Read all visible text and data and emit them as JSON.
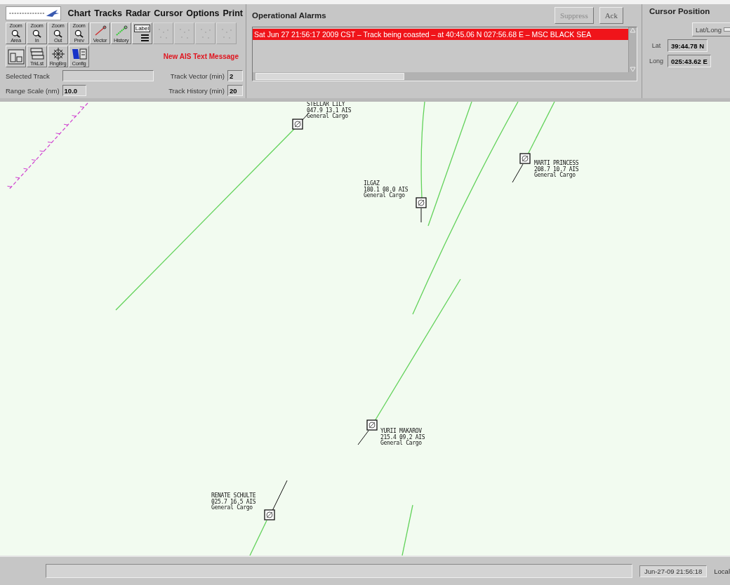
{
  "menu": [
    "Chart",
    "Tracks",
    "Radar",
    "Cursor",
    "Options",
    "Print"
  ],
  "toolbar": {
    "rows": [
      [
        {
          "kind": "zoom",
          "top": "Zoom",
          "caption": "Area",
          "disabled": false
        },
        {
          "kind": "zoom",
          "top": "Zoom",
          "caption": "In",
          "disabled": false
        },
        {
          "kind": "zoom",
          "top": "Zoom",
          "caption": "Out",
          "disabled": false
        },
        {
          "kind": "zoom",
          "top": "Zoom",
          "caption": "Prev",
          "disabled": false
        },
        {
          "kind": "vector",
          "caption": "Vector",
          "disabled": false
        },
        {
          "kind": "history",
          "caption": "History",
          "disabled": false
        },
        {
          "kind": "label",
          "caption": "Label",
          "disabled": false
        },
        {
          "kind": "faded",
          "disabled": true
        },
        {
          "kind": "faded",
          "disabled": true
        },
        {
          "kind": "faded",
          "disabled": true
        },
        {
          "kind": "faded",
          "disabled": true
        }
      ],
      [
        {
          "kind": "pip",
          "disabled": false
        },
        {
          "kind": "tracklist",
          "caption": "TrkLst",
          "disabled": false
        },
        {
          "kind": "rangebearing",
          "caption": "RngBrg",
          "disabled": false
        },
        {
          "kind": "config",
          "caption": "Config",
          "disabled": false
        }
      ]
    ],
    "notice": "New AIS Text Message",
    "fields": [
      {
        "label": "Selected Track"
      },
      {
        "label": "Track Vector (min)",
        "value": "2"
      },
      {
        "label": "Range Scale (nm)",
        "value": "10.0"
      },
      {
        "label": "Track History (min)",
        "value": "20"
      }
    ]
  },
  "alarms": {
    "title": "Operational Alarms",
    "buttons": [
      {
        "label": "Suppress",
        "disabled": true
      },
      {
        "label": "Ack",
        "disabled": false
      }
    ],
    "rows": [
      {
        "text": "Sat Jun 27 21:56:17 2009 CST – Track being coasted –  at  40:45.06 N 027:56.68 E – MSC BLACK SEA",
        "selected": true
      }
    ]
  },
  "cursor_position": {
    "title": "Cursor Position",
    "mode_button": "Lat/Long",
    "lat_label": "Lat",
    "lat": "39:44.78 N",
    "long_label": "Long",
    "long": "025:43.62 E"
  },
  "tracks": [
    {
      "name": "STELLAR LILY",
      "data": "047.9 13.1 AIS",
      "type": "General Cargo"
    },
    {
      "name": "MARTI PRINCESS",
      "data": "208.7 10.7 AIS",
      "type": "General Cargo"
    },
    {
      "name": "ILGAZ",
      "data": "180.1 08.0 AIS",
      "type": "General Cargo"
    },
    {
      "name": "YURII MAKAROV",
      "data": "215.4 09.2 AIS",
      "type": "General Cargo"
    },
    {
      "name": "RENATE SCHULTE",
      "data": "025.7 16.5 AIS",
      "type": "General Cargo"
    }
  ],
  "status_bar": {
    "time": "Jun-27-09 21:56:18",
    "zone": "Local"
  }
}
